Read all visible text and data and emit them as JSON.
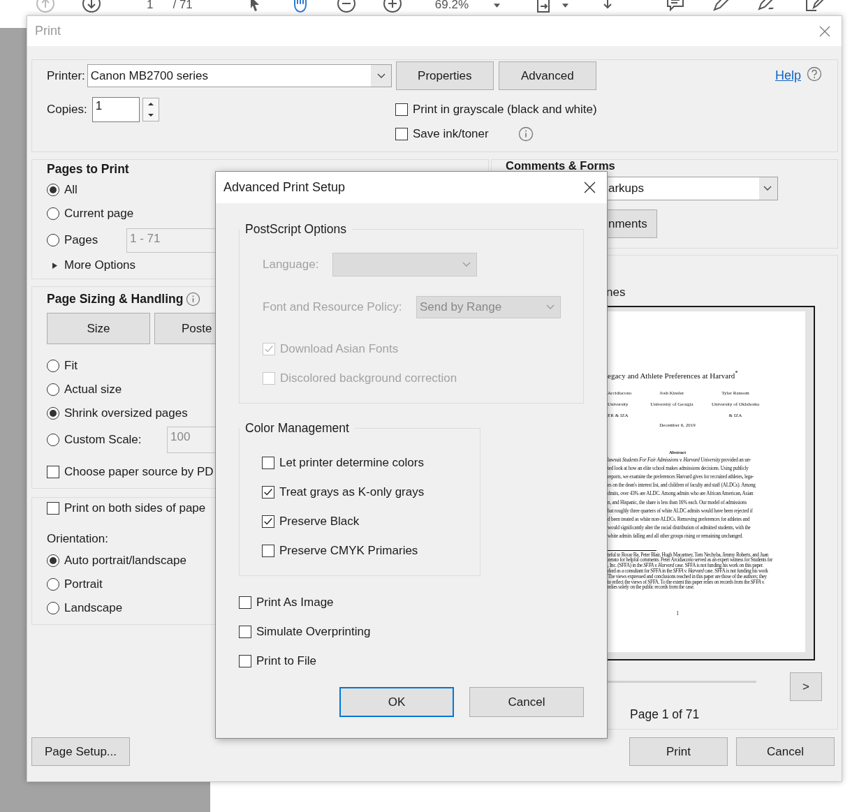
{
  "toolbar": {
    "page_number": "1",
    "page_total": "/ 71",
    "zoom": "69.2%"
  },
  "print_dialog": {
    "title": "Print",
    "printer_label": "Printer:",
    "printer": "Canon MB2700 series",
    "top_buttons": [
      "Properties",
      "Advanced"
    ],
    "help": "Help",
    "copies_label": "Copies:",
    "copies": "1",
    "options": [
      {
        "label": "Print in grayscale (black and white)",
        "checked": false,
        "info": false
      },
      {
        "label": "Save ink/toner",
        "checked": false,
        "info": true
      }
    ],
    "pages_to_print": {
      "title": "Pages to Print",
      "choices": [
        {
          "label": "All",
          "selected": true
        },
        {
          "label": "Current page",
          "selected": false
        },
        {
          "label": "Pages",
          "selected": false,
          "field": "1 - 71"
        }
      ],
      "more_options": "More Options"
    },
    "page_sizing": {
      "title": "Page Sizing & Handling",
      "tabs": [
        "Size",
        "Poste"
      ],
      "choices": [
        {
          "label": "Fit",
          "selected": false
        },
        {
          "label": "Actual size",
          "selected": false
        },
        {
          "label": "Shrink oversized pages",
          "selected": true
        },
        {
          "label": "Custom Scale:",
          "selected": false,
          "field": "100"
        }
      ],
      "paper_source": {
        "label": "Choose paper source by PD",
        "checked": false
      }
    },
    "duplex": {
      "label": "Print on both sides of pape",
      "checked": false
    },
    "orientation": {
      "label": "Orientation:",
      "choices": [
        {
          "label": "Auto portrait/landscape",
          "selected": true
        },
        {
          "label": "Portrait",
          "selected": false
        },
        {
          "label": "Landscape",
          "selected": false
        }
      ]
    },
    "comments": {
      "title": "Comments & Forms",
      "select": "arkups",
      "button": "nments"
    },
    "preview": {
      "caption": "nes",
      "next": ">",
      "page_label": "Page 1 of 71",
      "page": {
        "title": "egacy and Athlete Preferences at Harvard$^{*}$",
        "authors": [
          [
            "Arcidiacono",
            "University",
            "ER & IZA"
          ],
          [
            "Josh Kinsler",
            "University of Georgia"
          ],
          [
            "Tyler Ransom",
            "University of Oklahoma",
            "& IZA"
          ]
        ],
        "date": "December 6, 2019",
        "abstract_title": "Abstract",
        "abstract": [
          "lawsuit *Students For Fair Admissions v. Harvard University* provided an un-",
          "ted look at how an elite school makes admissions decisions. Using publicly",
          "reports, we examine the preferences Harvard gives for recruited athletes, lega-",
          "es on the dean's interest list, and children of faculty and staff (ALDCs). Among",
          "dmits, over 43% are ALDC. Among admits who are African American, Asian",
          "n, and Hispanic, the share is less than 16% each. Our model of admissions",
          "hat roughly three quarters of white ALDC admits would have been rejected if",
          "d been treated as white non-ALDCs. Removing preferences for athletes and",
          "would significantly alter the racial distribution of admitted students, with the",
          "white admits falling and all other groups rising or remaining unchanged."
        ],
        "footnotes": [
          "teful to Bocar Ba, Peter Blair, Hugh Macartney, Tom Nechyba, Jimmy Roberts, and Juan",
          "zerato for helpful comments. Peter Arcidiacono served as an expert witness for Students for",
          ", Inc. (SFFA) in the *SFFA v. Harvard* case. SFFA is not funding his work on this paper.",
          "rked as a consultant for SFFA in the *SFFA v. Harvard* case. SFFA is not funding his work",
          "The views expressed and conclusions reached in this paper are those of the authors; they",
          "to reflect the views of SFFA. To the extent this paper relies on records from the *SFFA v.*",
          "relies solely on the public records from the case."
        ],
        "page_number": "1"
      }
    },
    "bottom": {
      "page_setup": "Page Setup...",
      "print": "Print",
      "cancel": "Cancel"
    }
  },
  "advanced_dialog": {
    "title": "Advanced Print Setup",
    "postscript": {
      "title": "PostScript Options",
      "disabled": true,
      "language_label": "Language:",
      "policy_label": "Font and Resource Policy:",
      "policy": "Send by Range",
      "options": [
        {
          "label": "Download Asian Fonts",
          "checked": true
        },
        {
          "label": "Discolored background correction",
          "checked": false
        }
      ]
    },
    "color": {
      "title": "Color Management",
      "options": [
        {
          "label": "Let printer determine colors",
          "checked": false
        },
        {
          "label": "Treat grays as K-only grays",
          "checked": true
        },
        {
          "label": "Preserve Black",
          "checked": true
        },
        {
          "label": "Preserve CMYK Primaries",
          "checked": false
        }
      ]
    },
    "options": [
      {
        "label": "Print As Image",
        "checked": false
      },
      {
        "label": "Simulate Overprinting",
        "checked": false
      },
      {
        "label": "Print to File",
        "checked": false
      }
    ],
    "ok": "OK",
    "cancel": "Cancel"
  }
}
